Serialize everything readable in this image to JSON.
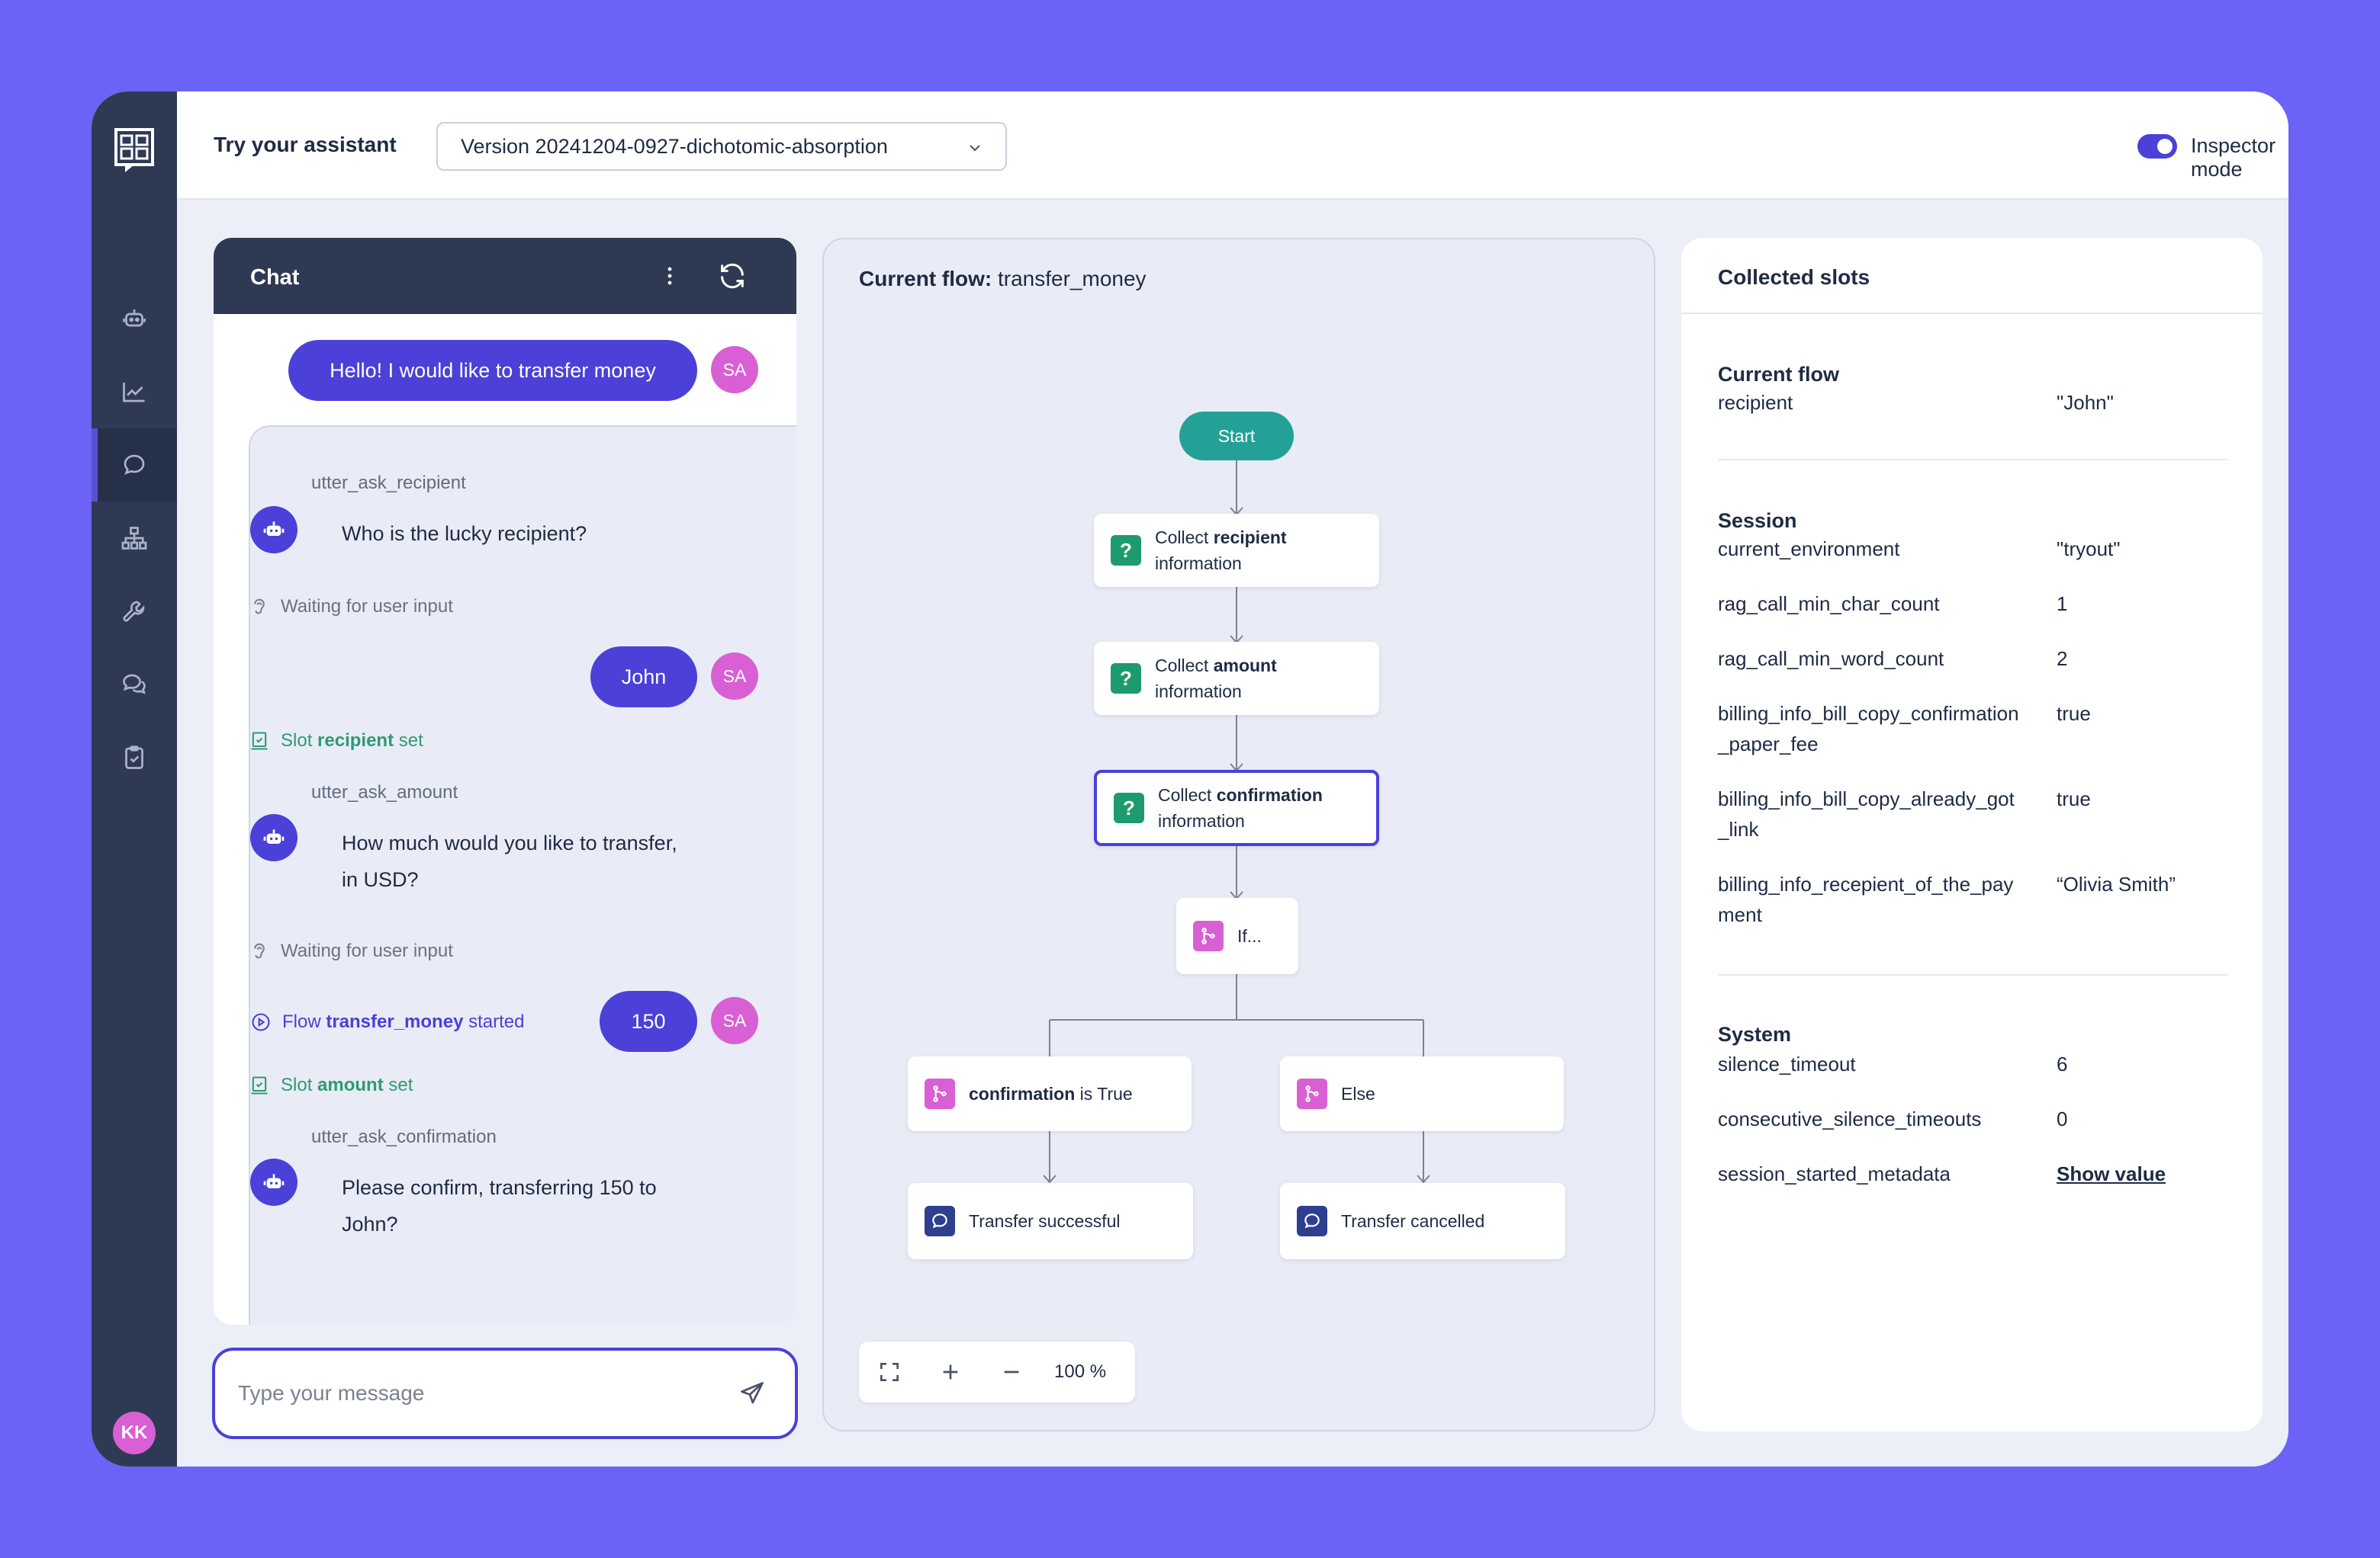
{
  "colors": {
    "accent": "#4b40d8",
    "background": "#6b63f5",
    "sidebar": "#2e3a54",
    "avatar": "#d95fd4",
    "start": "#23a197",
    "slot_event": "#2f9a73"
  },
  "sidebar": {
    "items": [
      {
        "icon": "bot-icon"
      },
      {
        "icon": "chart-icon"
      },
      {
        "icon": "chat-icon",
        "active": true
      },
      {
        "icon": "hierarchy-icon"
      },
      {
        "icon": "wrench-icon"
      },
      {
        "icon": "conversations-icon"
      },
      {
        "icon": "clipboard-check-icon"
      }
    ],
    "user_initials": "KK"
  },
  "header": {
    "title": "Try your assistant",
    "version": "Version 20241204-0927-dichotomic-absorption",
    "inspector_label": "Inspector mode",
    "inspector_on": true
  },
  "chat": {
    "title": "Chat",
    "avatar_initials": "SA",
    "messages": {
      "m1": "Hello! I would like to transfer money",
      "flow_prefix": "Flow",
      "flow_name": "transfer_money",
      "flow_suffix": "started",
      "utter1_name": "utter_ask_recipient",
      "utter1_text": "Who is the lucky recipient?",
      "wait1": "Waiting for user input",
      "m2": "John",
      "slot1_prefix": "Slot",
      "slot1_name": "recipient",
      "slot1_suffix": "set",
      "utter2_name": "utter_ask_amount",
      "utter2_line1": "How much would you like to transfer,",
      "utter2_line2": "in USD?",
      "wait2": "Waiting for user input",
      "m3": "150",
      "slot2_prefix": "Slot",
      "slot2_name": "amount",
      "slot2_suffix": "set",
      "utter3_name": "utter_ask_confirmation",
      "utter3_line1": "Please confirm, transferring 150 to",
      "utter3_line2": "John?"
    },
    "input_placeholder": "Type your message"
  },
  "flow": {
    "title_prefix": "Current flow:",
    "title_name": "transfer_money",
    "start": "Start",
    "collect_prefix": "Collect",
    "collect_suffix": "information",
    "collect_slots": [
      "recipient",
      "amount",
      "confirmation"
    ],
    "if_label": "If...",
    "branch_true_slot": "confirmation",
    "branch_true_suffix": "is True",
    "branch_else": "Else",
    "end_true": "Transfer successful",
    "end_else": "Transfer cancelled",
    "zoom_level": "100 %"
  },
  "slots": {
    "title": "Collected slots",
    "sections": {
      "current_flow": {
        "title": "Current flow",
        "rows": [
          {
            "name": "recipient",
            "value": "\"John\""
          }
        ]
      },
      "session": {
        "title": "Session",
        "rows": [
          {
            "name": "current_environment",
            "value": "\"tryout\""
          },
          {
            "name": "rag_call_min_char_count",
            "value": "1"
          },
          {
            "name": "rag_call_min_word_count",
            "value": "2"
          },
          {
            "name": "billing_info_bill_copy_confirmation_paper_fee",
            "value": "true"
          },
          {
            "name": "billing_info_bill_copy_already_got_link",
            "value": "true"
          },
          {
            "name": "billing_info_recepient_of_the_payment",
            "value": "“Olivia Smith”"
          }
        ]
      },
      "system": {
        "title": "System",
        "rows": [
          {
            "name": "silence_timeout",
            "value": "6"
          },
          {
            "name": "consecutive_silence_timeouts",
            "value": "0"
          },
          {
            "name": "session_started_metadata",
            "value": "Show value"
          }
        ]
      }
    }
  }
}
